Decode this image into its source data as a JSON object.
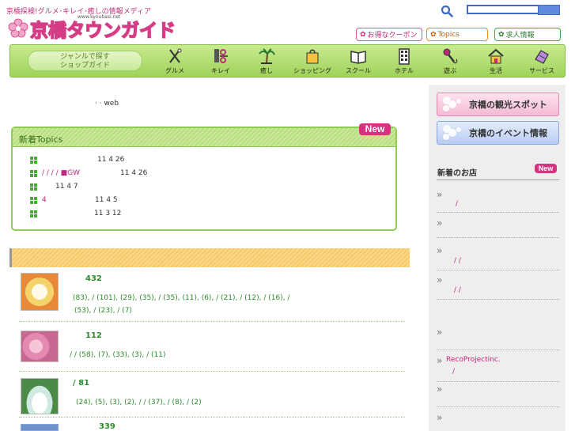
{
  "header": {
    "tagline": "京橋探検!グルメ･キレイ･癒しの情報メディア",
    "site_url": "www.kyoubasi.net",
    "logo_text": "京橋タウンガイド",
    "buttons": {
      "coupon": "お得なクーポン",
      "topics": "Topics",
      "jobs": "求人情報"
    },
    "search": {
      "placeholder": ""
    }
  },
  "nav": {
    "lead": [
      "ジャンルで探す",
      "ショップガイド"
    ],
    "items": [
      {
        "label": "グルメ",
        "icon": "fork-knife-icon"
      },
      {
        "label": "キレイ",
        "icon": "scissors-icon"
      },
      {
        "label": "癒し",
        "icon": "palm-tree-icon"
      },
      {
        "label": "ショッピング",
        "icon": "shopping-bag-icon"
      },
      {
        "label": "スクール",
        "icon": "book-icon"
      },
      {
        "label": "ホテル",
        "icon": "building-icon"
      },
      {
        "label": "遊ぶ",
        "icon": "microphone-icon"
      },
      {
        "label": "生活",
        "icon": "house-icon"
      },
      {
        "label": "サービス",
        "icon": "service-icon"
      }
    ]
  },
  "intro": "·   ·   web",
  "topics": {
    "title": "新着Topics",
    "new_label": "New",
    "items": [
      {
        "left": "",
        "text": "11 4 26"
      },
      {
        "left": "/  /  /    /   ■GW",
        "text": "11 4 26"
      },
      {
        "left": "",
        "text": "11 4 7"
      },
      {
        "left": "4",
        "text": "11 4 5"
      },
      {
        "left": "",
        "text": "11 3 12"
      }
    ]
  },
  "categories": [
    {
      "count": "432",
      "links": [
        "(83),  /   (101),  (29),  (35),  /   (35),   (11),  (6),  /  (21),  /  (12),   /   (16),  /",
        "(53),   /   (23),  /  (7)"
      ]
    },
    {
      "count": "112",
      "links": [
        "/  /   (58),    (7),   (33),    (3),  /  (11)"
      ]
    },
    {
      "count": "/      81",
      "links": [
        "(24),  (5),      (3),  (2),  /  /  (37),      /  (8),     /     (2)"
      ]
    },
    {
      "count": "339",
      "links": []
    }
  ],
  "sidebar": {
    "sights": "京橋の観光スポット",
    "events": "京橋のイベント情報",
    "new_shops_title": "新着のお店",
    "new_label": "New",
    "shops": [
      {
        "name": "",
        "sub": "/"
      },
      {
        "name": "",
        "sub": ""
      },
      {
        "name": "",
        "sub": "/  /"
      },
      {
        "name": "",
        "sub": "/  /"
      },
      {
        "name": "",
        "sub": ""
      },
      {
        "name": "RecoProjectinc.",
        "sub": "/"
      },
      {
        "name": "",
        "sub": ""
      },
      {
        "name": "",
        "sub": ""
      }
    ]
  },
  "colors": {
    "brand_pink": "#d43c86",
    "nav_green": "#a7d764",
    "link_green": "#2d8a2d",
    "accent_blue": "#3d6cc4"
  }
}
